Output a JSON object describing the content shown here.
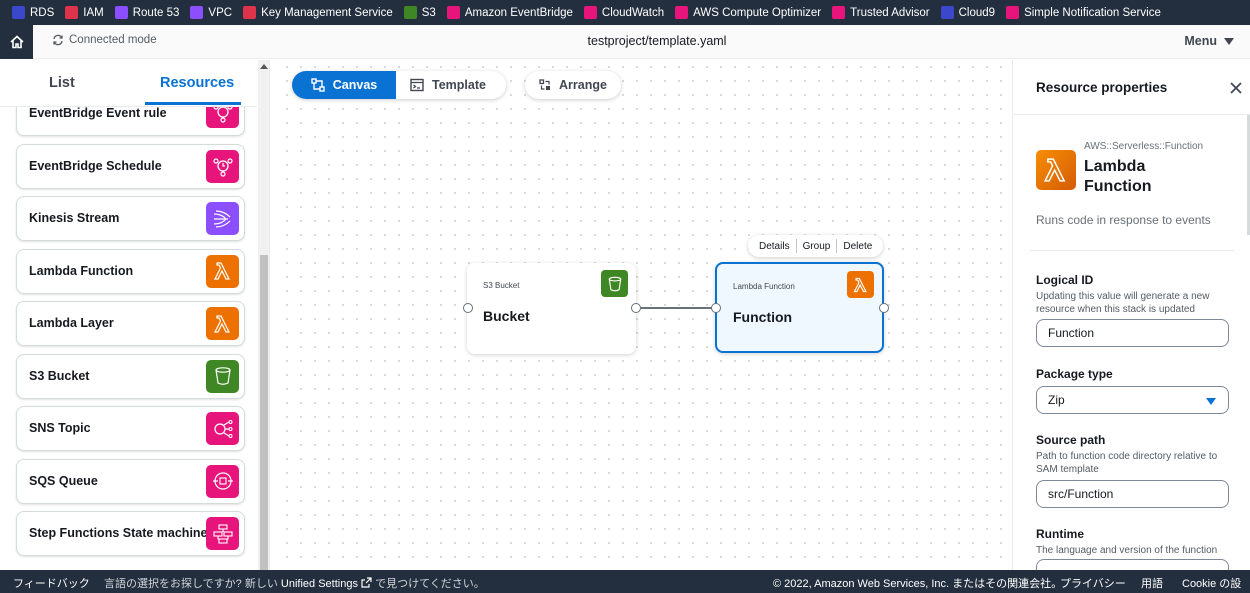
{
  "service_bar": {
    "items": [
      {
        "label": "RDS",
        "color": "#3b48cc"
      },
      {
        "label": "IAM",
        "color": "#dd344c"
      },
      {
        "label": "Route 53",
        "color": "#8c4fff"
      },
      {
        "label": "VPC",
        "color": "#8c4fff"
      },
      {
        "label": "Key Management Service",
        "color": "#dd344c"
      },
      {
        "label": "S3",
        "color": "#3f8624"
      },
      {
        "label": "Amazon EventBridge",
        "color": "#e7157b"
      },
      {
        "label": "CloudWatch",
        "color": "#e7157b"
      },
      {
        "label": "AWS Compute Optimizer",
        "color": "#e7157b"
      },
      {
        "label": "Trusted Advisor",
        "color": "#e7157b"
      },
      {
        "label": "Cloud9",
        "color": "#3b48cc"
      },
      {
        "label": "Simple Notification Service",
        "color": "#e7157b"
      }
    ]
  },
  "header": {
    "connected_mode": "Connected mode",
    "title": "testproject/template.yaml",
    "menu_label": "Menu"
  },
  "left_panel": {
    "tabs": [
      {
        "label": "List"
      },
      {
        "label": "Resources"
      }
    ],
    "active_tab": "Resources",
    "resources": [
      {
        "label": "EventBridge Event rule",
        "icon": "eventbridge-rule-icon",
        "color": "#e7157b"
      },
      {
        "label": "EventBridge Schedule",
        "icon": "eventbridge-schedule-icon",
        "color": "#e7157b"
      },
      {
        "label": "Kinesis Stream",
        "icon": "kinesis-icon",
        "color": "#8c4fff"
      },
      {
        "label": "Lambda Function",
        "icon": "lambda-icon",
        "color": "#ed7100"
      },
      {
        "label": "Lambda Layer",
        "icon": "lambda-icon",
        "color": "#ed7100"
      },
      {
        "label": "S3 Bucket",
        "icon": "s3-bucket-icon",
        "color": "#3f8624"
      },
      {
        "label": "SNS Topic",
        "icon": "sns-topic-icon",
        "color": "#e7157b"
      },
      {
        "label": "SQS Queue",
        "icon": "sqs-queue-icon",
        "color": "#e7157b"
      },
      {
        "label": "Step Functions State machine",
        "icon": "step-functions-icon",
        "color": "#e7157b"
      }
    ]
  },
  "canvas": {
    "view_tabs": [
      {
        "label": "Canvas"
      },
      {
        "label": "Template"
      }
    ],
    "active_view": "Canvas",
    "arrange_label": "Arrange",
    "context_menu": [
      "Details",
      "Group",
      "Delete"
    ],
    "nodes": [
      {
        "type": "S3 Bucket",
        "name": "Bucket",
        "icon": "s3-bucket-icon",
        "color": "#3f8624",
        "selected": false
      },
      {
        "type": "Lambda Function",
        "name": "Function",
        "icon": "lambda-icon",
        "color": "#ed7100",
        "selected": true
      }
    ]
  },
  "properties": {
    "title": "Resource properties",
    "resource_type": "AWS::Serverless::Function",
    "resource_name": "Lambda Function",
    "description": "Runs code in response to events",
    "fields": {
      "logical_id": {
        "label": "Logical ID",
        "description": "Updating this value will generate a new resource when this stack is updated",
        "value": "Function"
      },
      "package_type": {
        "label": "Package type",
        "value": "Zip"
      },
      "source_path": {
        "label": "Source path",
        "description": "Path to function code directory relative to SAM template",
        "value": "src/Function"
      },
      "runtime": {
        "label": "Runtime",
        "description": "The language and version of the function"
      }
    }
  },
  "footer": {
    "feedback": "フィードバック",
    "lang_prefix": "言語の選択をお探しですか? 新しい",
    "unified_settings": "Unified Settings",
    "lang_suffix": "で見つけてください。",
    "copyright": "© 2022, Amazon Web Services, Inc. またはその関連会社。",
    "privacy": "プライバシー",
    "terms": "用語",
    "cookie": "Cookie の設定"
  }
}
